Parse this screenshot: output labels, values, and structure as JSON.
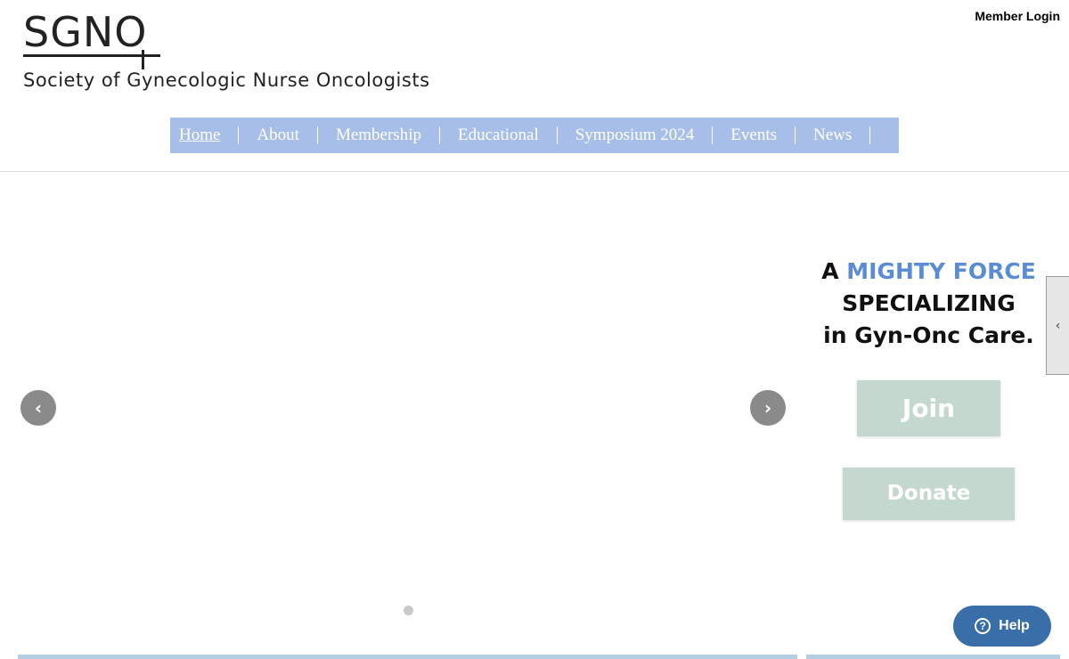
{
  "header": {
    "logo_text": "SGNO",
    "logo_tagline": "Society of Gynecologic Nurse Oncologists",
    "member_login": "Member Login"
  },
  "nav": {
    "items": [
      {
        "label": "Home"
      },
      {
        "label": "About"
      },
      {
        "label": "Membership"
      },
      {
        "label": "Educational"
      },
      {
        "label": "Symposium 2024"
      },
      {
        "label": "Events"
      },
      {
        "label": "News"
      }
    ]
  },
  "slider": {
    "prev_icon": "chevron-left-icon",
    "next_icon": "chevron-right-icon"
  },
  "hero": {
    "line1_a": "A",
    "line1_b": "MIGHTY FORCE",
    "line2": "SPECIALIZING",
    "line3": "in Gyn-Onc Care."
  },
  "buttons": {
    "join": "Join",
    "donate": "Donate"
  },
  "help": {
    "label": "Help"
  },
  "colors": {
    "nav_bg": "#a7bfe8",
    "accent_blue": "#5b8cd6",
    "cta_bg": "#c5d8cf",
    "help_bg": "#3a6ea8"
  }
}
